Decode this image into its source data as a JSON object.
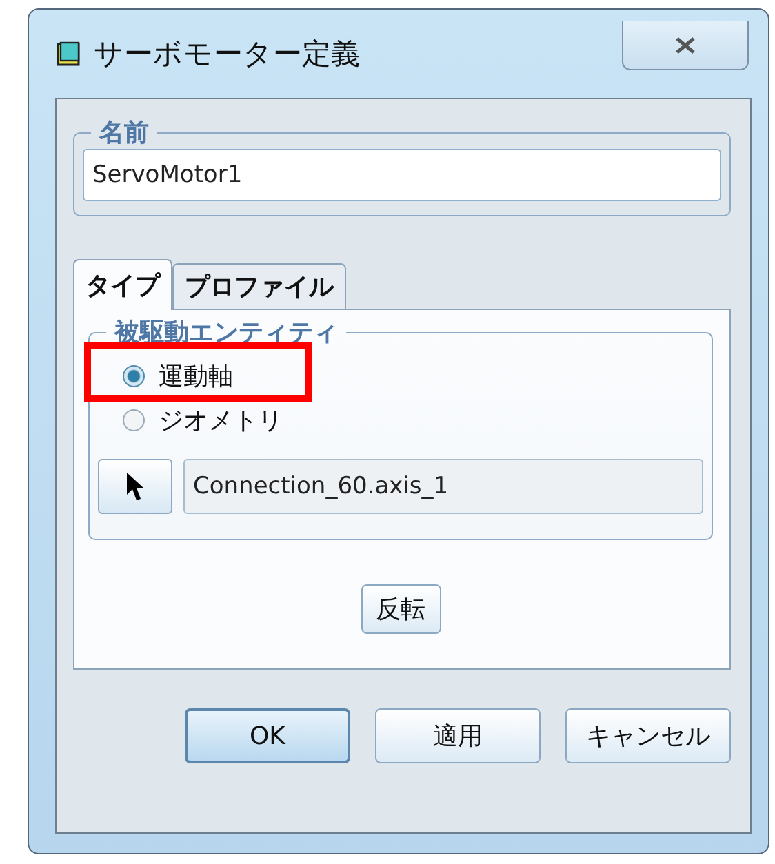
{
  "window": {
    "title": "サーボモーター定義"
  },
  "name_group": {
    "label": "名前",
    "value": "ServoMotor1"
  },
  "tabs": [
    {
      "label": "タイプ",
      "selected": true
    },
    {
      "label": "プロファイル",
      "selected": false
    }
  ],
  "driven_entity": {
    "label": "被駆動エンティティ",
    "options": [
      {
        "label": "運動軸",
        "selected": true,
        "highlighted": true
      },
      {
        "label": "ジオメトリ",
        "selected": false,
        "highlighted": false
      }
    ],
    "reference": "Connection_60.axis_1",
    "flip_button": "反転"
  },
  "buttons": [
    {
      "label": "OK",
      "default": true
    },
    {
      "label": "適用",
      "default": false
    },
    {
      "label": "キャンセル",
      "default": false
    }
  ]
}
